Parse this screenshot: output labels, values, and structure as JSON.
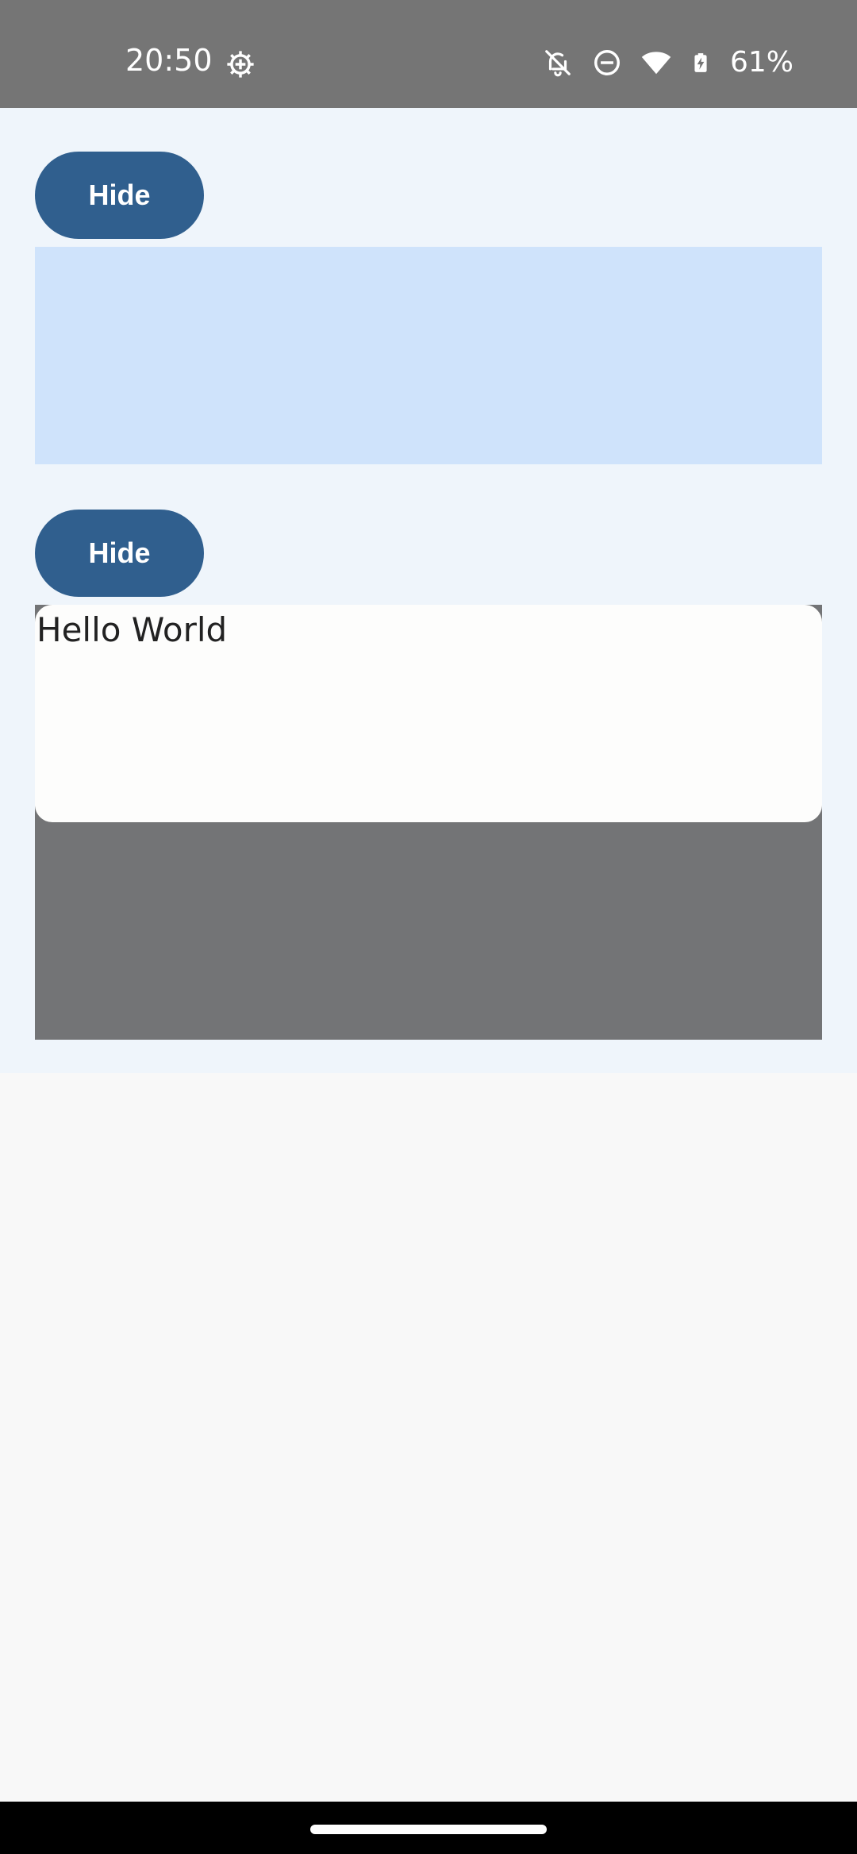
{
  "status_bar": {
    "time": "20:50",
    "battery": "61%",
    "icons": [
      "settings-icon",
      "notifications-off-icon",
      "do-not-disturb-icon",
      "wifi-icon",
      "battery-charging-icon"
    ]
  },
  "buttons": {
    "hide_1": "Hide",
    "hide_2": "Hide"
  },
  "card": {
    "text": "Hello World"
  },
  "colors": {
    "status_bar": "#757575",
    "content_bg": "#eff5fb",
    "button": "#305f8e",
    "blue_box": "#cfe3fb",
    "gray_box": "#737476",
    "card": "#fdfdfc"
  }
}
